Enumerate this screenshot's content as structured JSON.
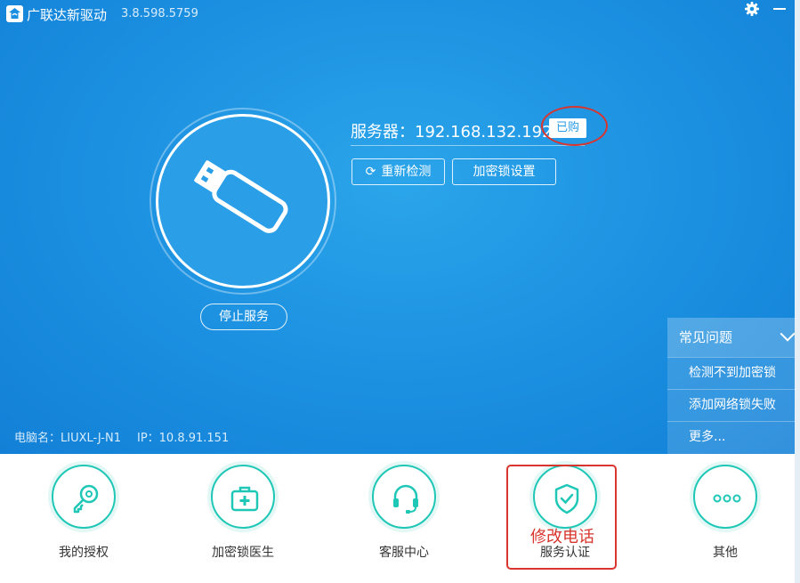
{
  "app": {
    "title": "广联达新驱动",
    "version": "3.8.598.5759"
  },
  "icons": {
    "logo": "gld-logo-icon",
    "settings": "gear-icon",
    "minimize": "minimize-icon",
    "refresh": "refresh-icon",
    "usb": "usb-dongle-icon",
    "chevron": "chevron-down-icon"
  },
  "main": {
    "stop_service": "停止服务",
    "server_label": "服务器：",
    "server_ip": "192.168.132.192",
    "purchased_badge": "已购",
    "redetect_label": "重新检测",
    "dongle_settings_label": "加密锁设置"
  },
  "pc_info": {
    "computer_name": "电脑名：LIUXL-J-N1",
    "ip": "IP：10.8.91.151"
  },
  "faq": {
    "title": "常见问题",
    "items": [
      "检测不到加密锁",
      "添加网络锁失败",
      "更多..."
    ]
  },
  "bottom_nav": [
    {
      "label": "我的授权",
      "icon": "key-icon"
    },
    {
      "label": "加密锁医生",
      "icon": "medical-kit-icon"
    },
    {
      "label": "客服中心",
      "icon": "headset-icon"
    },
    {
      "label": "服务认证",
      "icon": "shield-check-icon"
    },
    {
      "label": "其他",
      "icon": "more-dots-icon"
    }
  ],
  "annotation": "修改电话",
  "colors": {
    "primary_blue": "#1b8fe0",
    "teal": "#1fc7b6",
    "annotation_red": "#d9352e"
  }
}
